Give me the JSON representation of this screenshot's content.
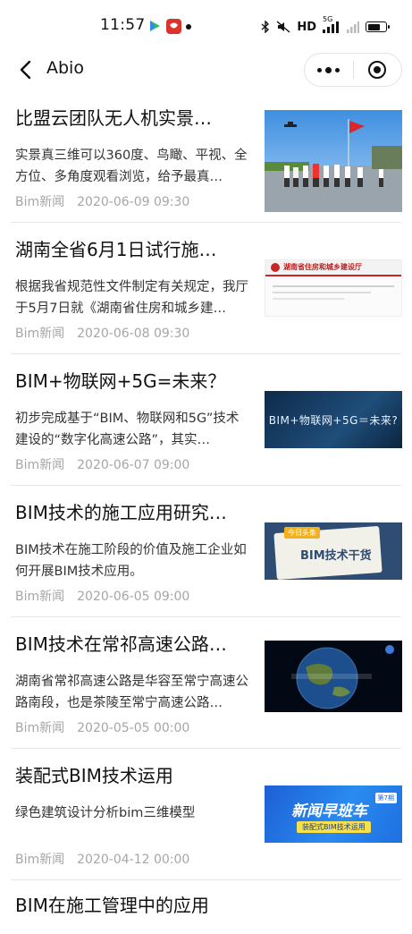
{
  "status_bar": {
    "time": "11:57",
    "network": "HD",
    "signal_label": "5G",
    "battery_level": 0.75,
    "icons": [
      "video-app-icon",
      "red-app-icon",
      "bluetooth-icon",
      "mute-icon",
      "signal-icon",
      "battery-icon"
    ]
  },
  "navbar": {
    "back_icon": "chevron-left-icon",
    "title": "Abio",
    "more_icon": "more-dots-icon",
    "close_icon": "target-icon"
  },
  "colors": {
    "title": "#111111",
    "meta": "#a6a6a6",
    "divider": "#e6e6e6"
  },
  "articles": [
    {
      "title": "比盟云团队无人机实景…",
      "desc": "实景真三维可以360度、鸟瞰、平视、全方位、多角度观看浏览，给予最真…",
      "source": "Bim新闻",
      "date": "2020-06-09 09:30",
      "thumb": "drone-team-photo"
    },
    {
      "title": "湖南全省6月1日试行施…",
      "desc": "根据我省规范性文件制定有关规定，我厅于5月7日就《湖南省住房和城乡建…",
      "source": "Bim新闻",
      "date": "2020-06-08 09:30",
      "thumb": "document-screenshot",
      "thumb_header": "湖南省住房和城乡建设厅"
    },
    {
      "title": "BIM+物联网+5G=未来？",
      "desc": "初步完成基于“BIM、物联网和5G”技术建设的“数字化高速公路”，其实…",
      "source": "Bim新闻",
      "date": "2020-06-07 09:00",
      "thumb": "bim-5g-banner",
      "thumb_text": "BIM+物联网+5G＝未来?"
    },
    {
      "title": "BIM技术的施工应用研究…",
      "desc": "BIM技术在施工阶段的价值及施工企业如何开展BIM技术应用。",
      "source": "Bim新闻",
      "date": "2020-06-05 09:00",
      "thumb": "bim-tech-banner",
      "thumb_text": "BIM技术干货",
      "thumb_tag": "今日头条"
    },
    {
      "title": "BIM技术在常祁高速公路…",
      "desc": "湖南省常祁高速公路是华容至常宁高速公路南段，也是茶陵至常宁高速公路…",
      "source": "Bim新闻",
      "date": "2020-05-05 00:00",
      "thumb": "earth-globe-banner"
    },
    {
      "title": "装配式BIM技术运用",
      "desc": "绿色建筑设计分析bim三维模型",
      "source": "Bim新闻",
      "date": "2020-04-12 00:00",
      "thumb": "news-express-banner",
      "thumb_text": "新闻早班车",
      "thumb_sub": "装配式BIM技术运用",
      "thumb_badge": "第7期"
    }
  ],
  "partial_article": {
    "title": "BIM在施工管理中的应用"
  }
}
